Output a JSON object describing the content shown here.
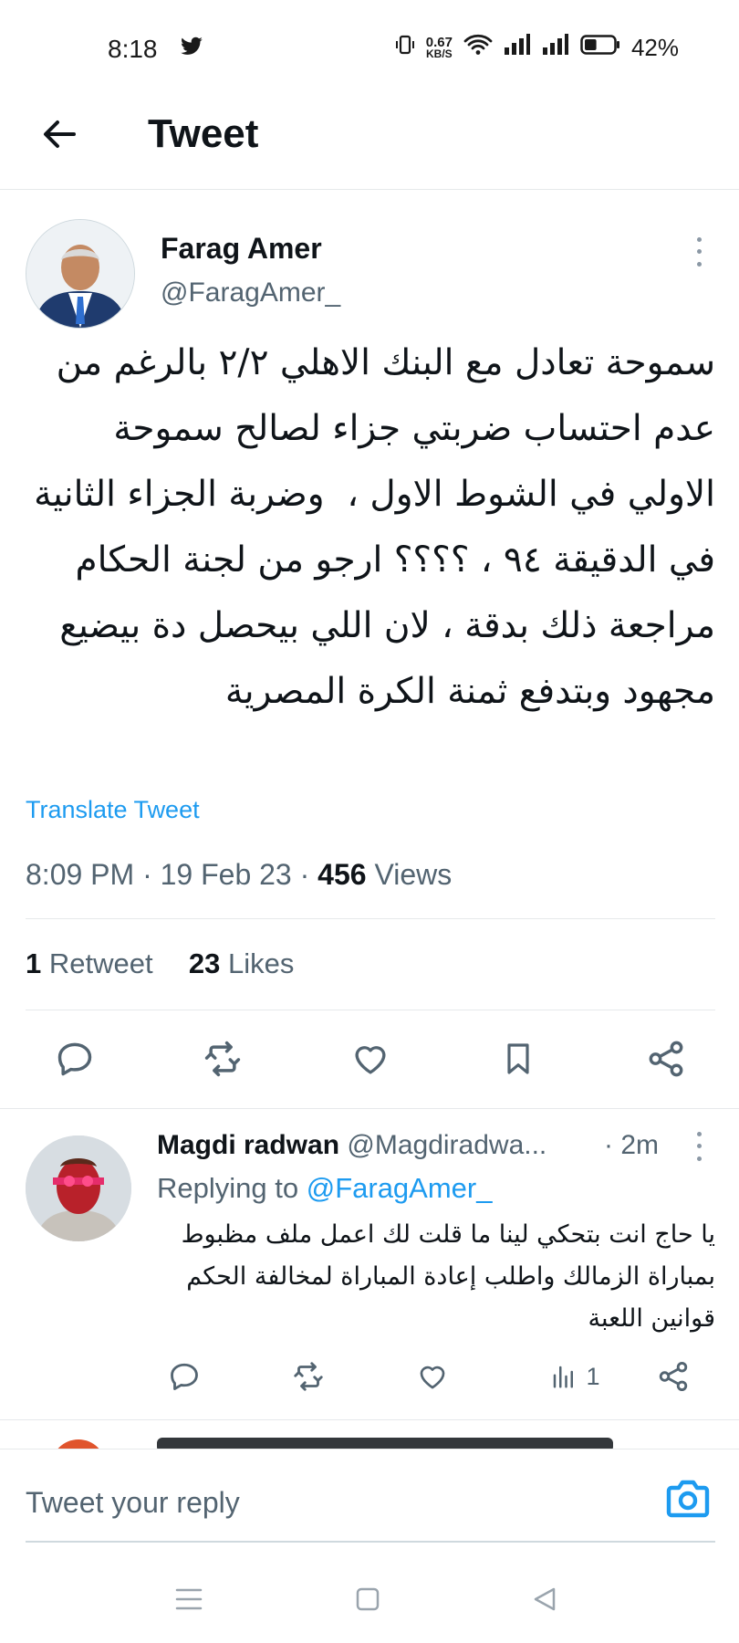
{
  "status_bar": {
    "time": "8:18",
    "network_speed_value": "0.67",
    "network_speed_unit": "KB/S",
    "battery_percent": "42%",
    "battery_level": 0.42,
    "icons": [
      "twitter-icon",
      "vibrate-icon",
      "wifi-icon",
      "signal-icon",
      "signal-icon",
      "battery-icon"
    ]
  },
  "header": {
    "title": "Tweet",
    "back_icon": "arrow-left-icon"
  },
  "tweet": {
    "author_name": "Farag Amer",
    "author_handle": "@FaragAmer_",
    "text": "سموحة تعادل مع البنك الاهلي ٢/٢ بالرغم من عدم احتساب ضربتي جزاء لصالح سموحة الاولي في الشوط الاول ،  وضربة الجزاء الثانية في الدقيقة ٩٤ ، ؟؟؟؟ ارجو من لجنة الحكام مراجعة ذلك بدقة ، لان اللي بيحصل دة بيضيع مجهود وبتدفع ثمنة الكرة المصرية",
    "translate_label": "Translate Tweet",
    "time": "8:09 PM",
    "date": "19 Feb 23",
    "views_count": "456",
    "views_label": "Views",
    "retweets_count": "1",
    "retweets_label": "Retweet",
    "likes_count": "23",
    "likes_label": "Likes",
    "actions": [
      "reply-icon",
      "retweet-icon",
      "like-icon",
      "bookmark-icon",
      "share-icon"
    ]
  },
  "reply": {
    "author_name": "Magdi radwan",
    "author_handle": "@Magdiradwa...",
    "time": "· 2m",
    "replying_prefix": "Replying to",
    "replying_to": "@FaragAmer_",
    "text": "يا حاج انت بتحكي لينا ما قلت لك اعمل ملف مظبوط بمباراة الزمالك واطلب إعادة المباراة لمخالفة الحكم قوانين اللعبة",
    "views_count": "1",
    "actions": [
      "reply-icon",
      "retweet-icon",
      "like-icon",
      "views-icon",
      "share-icon"
    ]
  },
  "composer": {
    "placeholder": "Tweet your reply",
    "camera_icon": "camera-icon"
  },
  "nav_bar": {
    "icons": [
      "menu-icon",
      "home-square-icon",
      "back-triangle-icon"
    ]
  },
  "colors": {
    "accent": "#1d9bf0",
    "text": "#0f1419",
    "secondary": "#536471",
    "divider": "#e6e9eb"
  }
}
